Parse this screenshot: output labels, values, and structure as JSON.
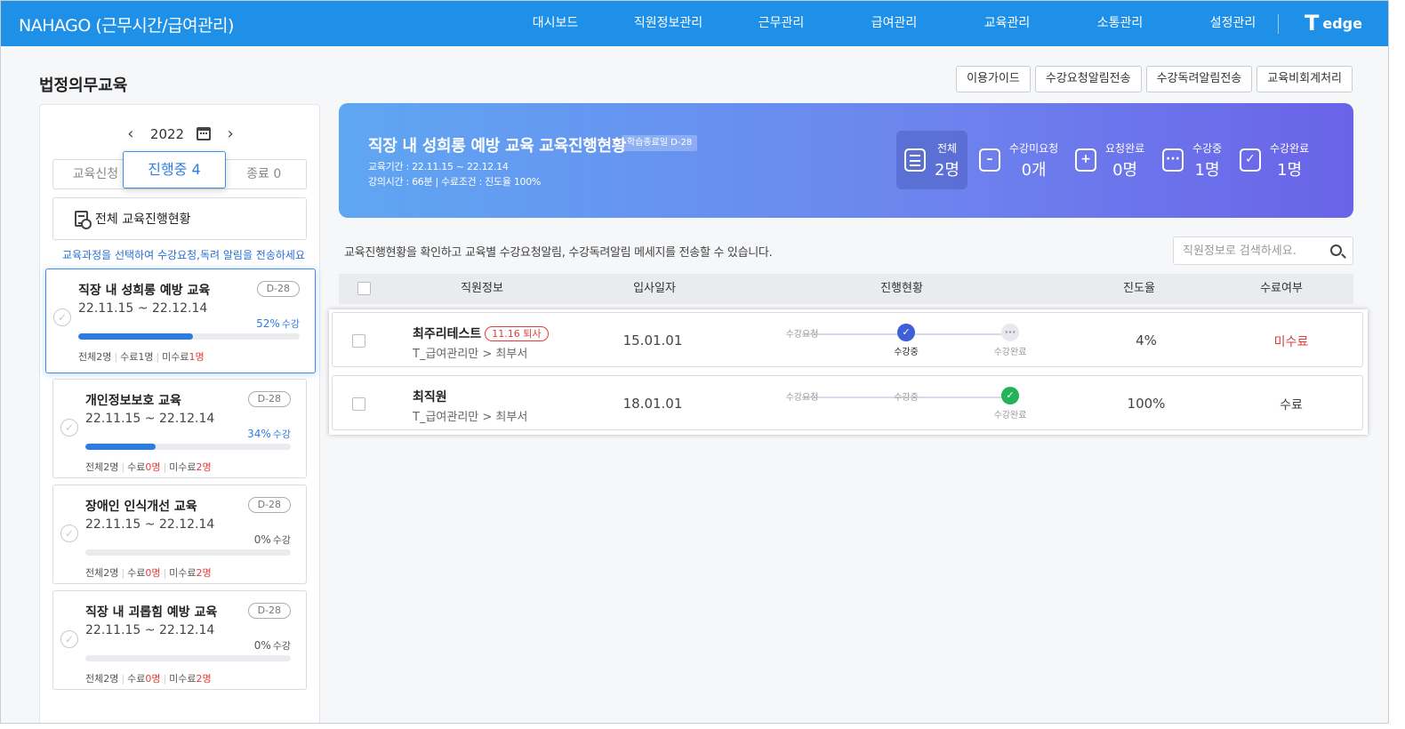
{
  "header": {
    "brand": "NAHAGO (근무시간/급여관리)",
    "nav": [
      "대시보드",
      "직원정보관리",
      "근무관리",
      "급여관리",
      "교육관리",
      "소통관리",
      "설정관리"
    ],
    "logo_t": "T",
    "logo_text": "edge"
  },
  "page": {
    "title": "법정의무교육"
  },
  "actions": [
    "이용가이드",
    "수강요청알림전송",
    "수강독려알림전송",
    "교육비회계처리"
  ],
  "left": {
    "year": "2022",
    "tabs": {
      "apply": "교육신청",
      "progress": "진행중 4",
      "ended": "종료 0"
    },
    "all_status_label": "전체 교육진행현황",
    "hint": "교육과정을 선택하여 수강요청,독려 알림을 전송하세요",
    "courses": [
      {
        "name": "직장 내 성희롱 예방 교육",
        "dday": "D-28",
        "period": "22.11.15 ~ 22.12.14",
        "percent": "52%",
        "percent_suffix": "수강",
        "progress": 0.52,
        "total": "전체2명",
        "done_label": "수료",
        "done": "1명",
        "notdone_label": "미수료",
        "notdone": "1명"
      },
      {
        "name": "개인정보보호 교육",
        "dday": "D-28",
        "period": "22.11.15 ~ 22.12.14",
        "percent": "34%",
        "percent_suffix": "수강",
        "progress": 0.34,
        "total": "전체2명",
        "done_label": "수료",
        "done": "0명",
        "notdone_label": "미수료",
        "notdone": "2명"
      },
      {
        "name": "장애인 인식개선 교육",
        "dday": "D-28",
        "period": "22.11.15 ~ 22.12.14",
        "percent": "0%",
        "percent_suffix": "수강",
        "progress": 0,
        "total": "전체2명",
        "done_label": "수료",
        "done": "0명",
        "notdone_label": "미수료",
        "notdone": "2명"
      },
      {
        "name": "직장 내 괴롭힘 예방 교육",
        "dday": "D-28",
        "period": "22.11.15 ~ 22.12.14",
        "percent": "0%",
        "percent_suffix": "수강",
        "progress": 0,
        "total": "전체2명",
        "done_label": "수료",
        "done": "0명",
        "notdone_label": "미수료",
        "notdone": "2명"
      }
    ]
  },
  "banner": {
    "title": "직장 내 성희롱 예방 교육 교육진행현황",
    "badge": "학습종료일 D-28",
    "period_line": "교육기간 : 22.11.15 ~ 22.12.14",
    "time_line": "강의시간 : 66분  |  수료조건 : 진도율 100%",
    "stats": [
      {
        "label": "전체",
        "value": "2명",
        "icon": "list-icon"
      },
      {
        "label": "수강미요청",
        "value": "0개",
        "icon": "minus-icon"
      },
      {
        "label": "요청완료",
        "value": "0명",
        "icon": "plus-icon"
      },
      {
        "label": "수강중",
        "value": "1명",
        "icon": "dots-icon"
      },
      {
        "label": "수강완료",
        "value": "1명",
        "icon": "check-icon"
      }
    ]
  },
  "table": {
    "description": "교육진행현황을 확인하고 교육별 수강요청알림, 수강독려알림 메세지를 전송할 수 있습니다.",
    "search_placeholder": "직원정보로 검색하세요.",
    "columns": [
      "직원정보",
      "입사일자",
      "진행현황",
      "진도율",
      "수료여부"
    ],
    "step_labels": [
      "수강요청",
      "수강중",
      "수강완료"
    ],
    "rows": [
      {
        "name": "최주리테스트",
        "badge": "11.16 퇴사",
        "dept": "T_급여관리만 > 최부서",
        "hire": "15.01.01",
        "steps": [
          "done",
          "current",
          "pending"
        ],
        "progress": "4%",
        "status": "미수료"
      },
      {
        "name": "최직원",
        "badge": "",
        "dept": "T_급여관리만 > 최부서",
        "hire": "18.01.01",
        "steps": [
          "done",
          "done",
          "complete"
        ],
        "progress": "100%",
        "status": "수료"
      }
    ]
  },
  "colors": {
    "nav": "#1e90e8",
    "accent": "#2d7de0",
    "red": "#e23b3b",
    "green": "#25b35a"
  }
}
